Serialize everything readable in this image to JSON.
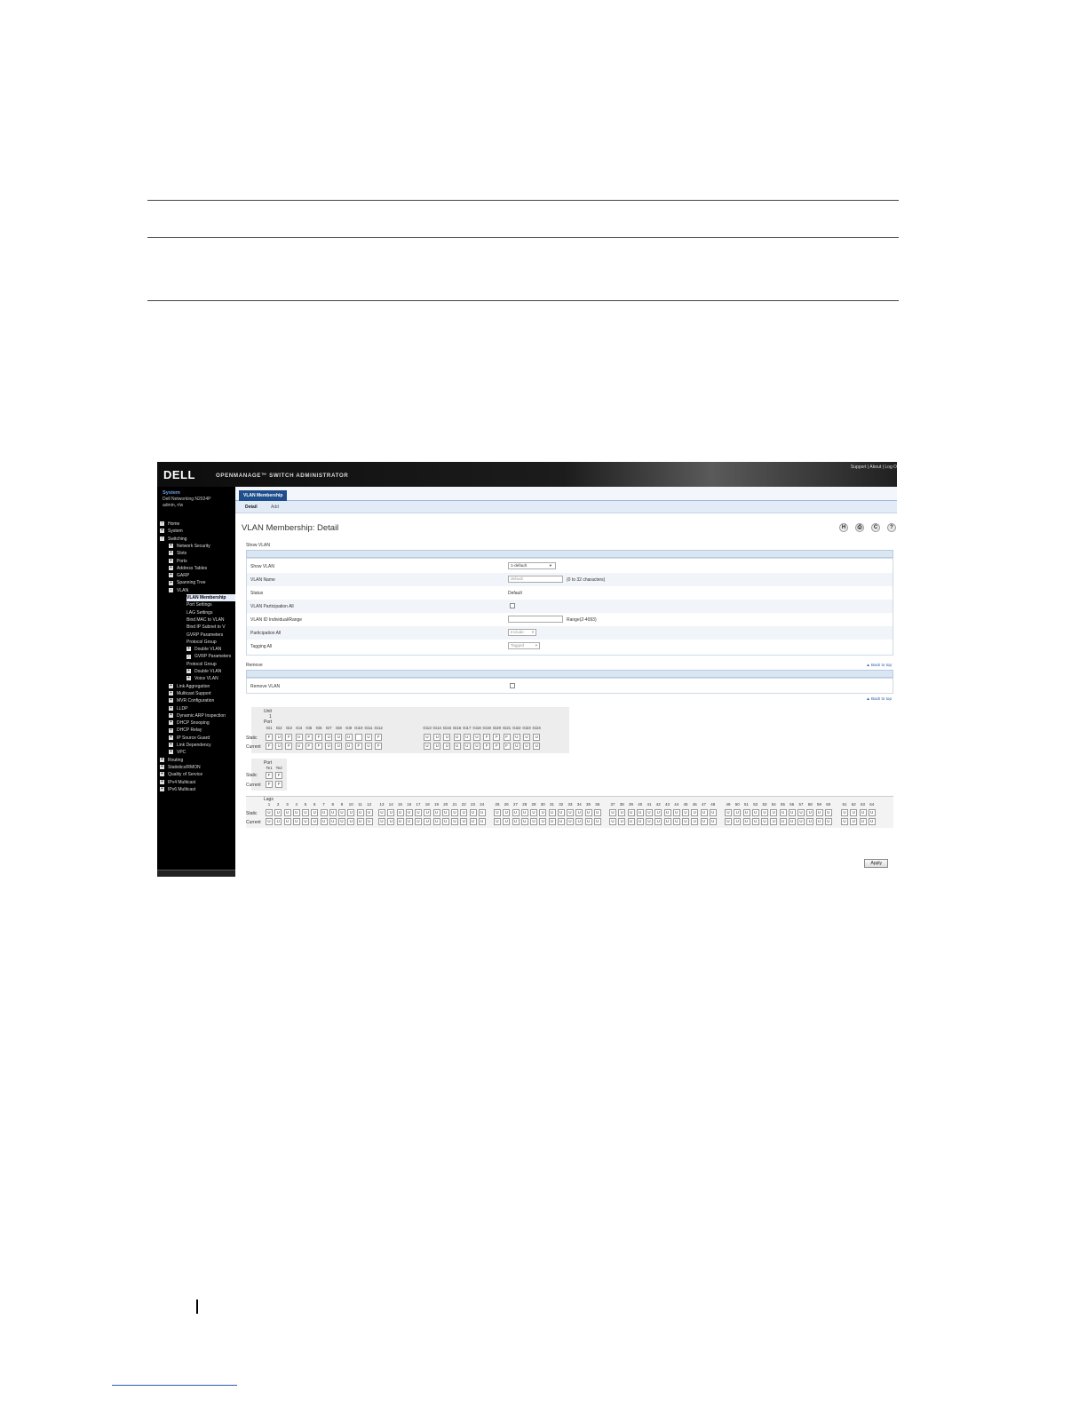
{
  "banner": {
    "logo": "DELL",
    "product": "OPENMANAGE™ SWITCH ADMINISTRATOR",
    "links": "Support | About | Log O"
  },
  "sidebar": {
    "title": "System",
    "model": "Dell Networking N2024P",
    "user": "admin, r/w",
    "tree": [
      {
        "label": "Home",
        "level": 0,
        "marker": "-"
      },
      {
        "label": "System",
        "level": 0,
        "marker": "+"
      },
      {
        "label": "Switching",
        "level": 0,
        "marker": "-"
      },
      {
        "label": "Network Security",
        "level": 1,
        "marker": "+"
      },
      {
        "label": "Slots",
        "level": 1,
        "marker": "+"
      },
      {
        "label": "Ports",
        "level": 1,
        "marker": "+"
      },
      {
        "label": "Address Tables",
        "level": 1,
        "marker": "+"
      },
      {
        "label": "GARP",
        "level": 1,
        "marker": "+"
      },
      {
        "label": "Spanning Tree",
        "level": 1,
        "marker": "+"
      },
      {
        "label": "VLAN",
        "level": 1,
        "marker": "-"
      },
      {
        "label": "VLAN Membership",
        "level": 2,
        "marker": "",
        "selected": true
      },
      {
        "label": "Port Settings",
        "level": 2,
        "marker": ""
      },
      {
        "label": "LAG Settings",
        "level": 2,
        "marker": ""
      },
      {
        "label": "Bind MAC to VLAN",
        "level": 2,
        "marker": ""
      },
      {
        "label": "Bind IP Subnet to V",
        "level": 2,
        "marker": ""
      },
      {
        "label": "GVRP Parameters",
        "level": 2,
        "marker": ""
      },
      {
        "label": "Protocol Group",
        "level": 2,
        "marker": ""
      },
      {
        "label": "Double VLAN",
        "level": 2,
        "marker": "+"
      },
      {
        "label": "GVRP Parameters",
        "level": 2,
        "marker": "-"
      },
      {
        "label": "Protocol Group",
        "level": 2,
        "marker": ""
      },
      {
        "label": "Double VLAN",
        "level": 2,
        "marker": "+"
      },
      {
        "label": "Voice VLAN",
        "level": 2,
        "marker": "+"
      },
      {
        "label": "Link Aggregation",
        "level": 1,
        "marker": "+"
      },
      {
        "label": "Multicast Support",
        "level": 1,
        "marker": "+"
      },
      {
        "label": "MVR Configuration",
        "level": 1,
        "marker": "+"
      },
      {
        "label": "LLDP",
        "level": 1,
        "marker": "+"
      },
      {
        "label": "Dynamic ARP Inspection",
        "level": 1,
        "marker": "+"
      },
      {
        "label": "DHCP Snooping",
        "level": 1,
        "marker": "+"
      },
      {
        "label": "DHCP Relay",
        "level": 1,
        "marker": "+"
      },
      {
        "label": "IP Source Guard",
        "level": 1,
        "marker": "+"
      },
      {
        "label": "Link Dependency",
        "level": 1,
        "marker": "+"
      },
      {
        "label": "VPC",
        "level": 1,
        "marker": "+"
      },
      {
        "label": "Routing",
        "level": 0,
        "marker": "+"
      },
      {
        "label": "Statistics/RMON",
        "level": 0,
        "marker": "+"
      },
      {
        "label": "Quality of Service",
        "level": 0,
        "marker": "+"
      },
      {
        "label": "IPv4 Multicast",
        "level": 0,
        "marker": "+"
      },
      {
        "label": "IPv6 Multicast",
        "level": 0,
        "marker": "+"
      }
    ]
  },
  "tabs": {
    "main": "VLAN Membership",
    "detail": "Detail",
    "add": "Add"
  },
  "page": {
    "title": "VLAN Membership: Detail"
  },
  "toolbar": {
    "save_icon": "H",
    "print_icon": "print",
    "refresh_icon": "C",
    "help_icon": "?"
  },
  "show_vlan": {
    "section": "Show VLAN",
    "rows": {
      "show_vlan_label": "Show VLAN",
      "show_vlan_value": "1-default",
      "vlan_name_label": "VLAN Name",
      "vlan_name_value": "default",
      "vlan_name_hint": "(0 to 32 characters)",
      "status_label": "Status",
      "status_value": "Default",
      "participation_all_label": "VLAN Participation All",
      "vlan_id_label": "VLAN ID Individual/Range",
      "vlan_id_hint": "Range(2-4093)",
      "participation_label": "Participation All",
      "participation_value": "Include",
      "tagging_label": "Tagging All",
      "tagging_value": "Tagged"
    }
  },
  "remove": {
    "section": "Remove",
    "back_to_top": "Back to top",
    "remove_vlan_label": "Remove VLAN",
    "back_to_top_2": "Back to top"
  },
  "ports": {
    "unit_label": "Unit",
    "unit_value": "1",
    "port_label": "Port",
    "static_label": "Static",
    "current_label": "Current",
    "group_a": {
      "names": [
        "Gi1",
        "Gi2",
        "Gi3",
        "Gi4",
        "Gi5",
        "Gi6",
        "Gi7",
        "Gi8",
        "Gi9",
        "Gi10",
        "Gi11",
        "Gi12"
      ],
      "static": [
        "F",
        "U",
        "F",
        "U",
        "F",
        "F",
        "U",
        "U",
        "U",
        "",
        "U",
        "F"
      ],
      "current": [
        "F",
        "U",
        "F",
        "U",
        "F",
        "F",
        "U",
        "U",
        "U",
        "F",
        "U",
        "F"
      ]
    },
    "group_b": {
      "names": [
        "Gi13",
        "Gi14",
        "Gi15",
        "Gi16",
        "Gi17",
        "Gi18",
        "Gi19",
        "Gi20",
        "Gi21",
        "Gi22",
        "Gi23",
        "Gi24"
      ],
      "static": [
        "U",
        "U",
        "U",
        "U",
        "U",
        "U",
        "F",
        "F",
        "F",
        "U",
        "U",
        "U"
      ],
      "current": [
        "U",
        "U",
        "U",
        "U",
        "U",
        "U",
        "F",
        "F",
        "F",
        "U",
        "U",
        "U"
      ]
    },
    "te": {
      "names": [
        "Te1",
        "Te2"
      ],
      "static": [
        "F",
        "F"
      ],
      "current": [
        "F",
        "F"
      ]
    }
  },
  "lags": {
    "label": "Lags",
    "groups": [
      {
        "names": [
          "1",
          "2",
          "3",
          "4",
          "5",
          "6",
          "7",
          "8",
          "9",
          "10",
          "11",
          "12"
        ]
      },
      {
        "names": [
          "13",
          "14",
          "15",
          "16",
          "17",
          "18",
          "19",
          "20",
          "21",
          "22",
          "23",
          "24"
        ]
      },
      {
        "names": [
          "25",
          "26",
          "27",
          "28",
          "29",
          "30",
          "31",
          "32",
          "33",
          "34",
          "35",
          "36"
        ]
      },
      {
        "names": [
          "37",
          "38",
          "39",
          "40",
          "41",
          "42",
          "43",
          "44",
          "45",
          "46",
          "47",
          "48"
        ]
      },
      {
        "names": [
          "49",
          "50",
          "51",
          "52",
          "53",
          "54",
          "55",
          "56",
          "57",
          "58",
          "59",
          "60"
        ]
      },
      {
        "names": [
          "61",
          "62",
          "63",
          "64"
        ]
      }
    ],
    "cell_value": "U"
  },
  "apply_label": "Apply"
}
